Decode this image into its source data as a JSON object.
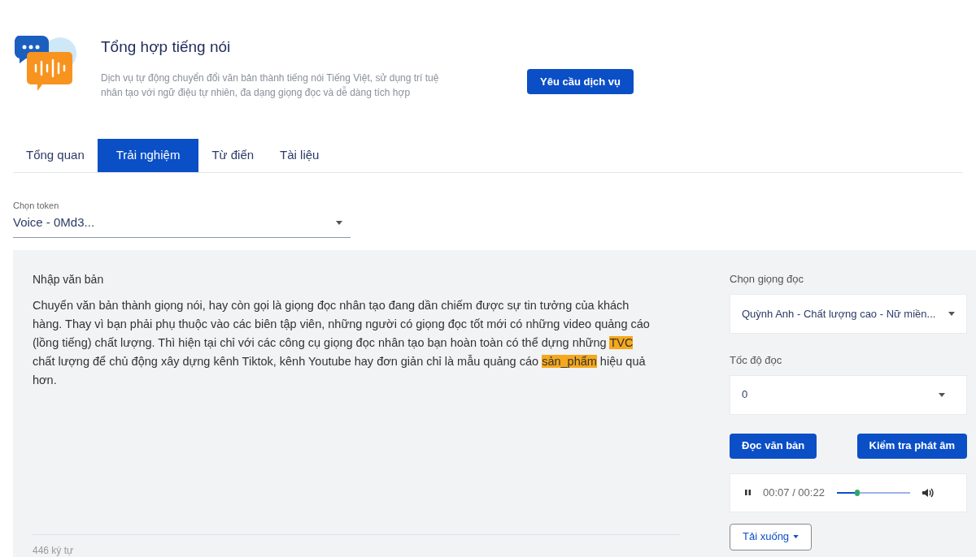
{
  "header": {
    "title": "Tổng hợp tiếng nói",
    "description": "Dịch vụ tự động chuyển đổi văn bản thành tiếng nói Tiếng Việt, sử dụng trí tuệ nhân tạo với ngữ điệu tự nhiên, đa dạng giọng đọc và dễ dàng tích hợp",
    "button": "Yêu cầu dịch vụ"
  },
  "tabs": [
    {
      "label": "Tổng quan",
      "selected": false
    },
    {
      "label": "Trải nghiệm",
      "selected": true
    },
    {
      "label": "Từ điển",
      "selected": false
    },
    {
      "label": "Tài liệu",
      "selected": false
    }
  ],
  "token": {
    "label": "Chọn token",
    "value": "Voice - 0Md3..."
  },
  "editor": {
    "label": "Nhập văn bản",
    "segments": [
      {
        "text": "Chuyển văn bản thành giọng nói, hay còn gọi là giọng đọc nhân tạo đang dần chiếm được sự tin tưởng của khách hàng. Thay vì bạn phải phụ thuộc vào các biên tập viên, những người có giọng đọc tốt mới có những video quảng cáo (lồng tiếng) chất lượng. Thì hiện tại chỉ với các công cụ giọng đọc nhân tạo bạn hoàn toàn có thể dựng những ",
        "highlighted": false
      },
      {
        "text": "TVC",
        "highlighted": true
      },
      {
        "text": " chất lượng để chủ động xây dựng kênh Tiktok, kênh Youtube hay đơn giản chỉ là mẫu quảng cáo ",
        "highlighted": false
      },
      {
        "text": "sản_phẩm",
        "highlighted": true
      },
      {
        "text": " hiệu quả hơn.",
        "highlighted": false
      }
    ],
    "count": "446 ký tự"
  },
  "voice": {
    "label": "Chọn giọng đọc",
    "value": "Quỳnh Anh - Chất lượng cao - Nữ miền..."
  },
  "speed": {
    "label": "Tốc độ đọc",
    "value": "0"
  },
  "buttons": [
    "Đọc văn bản",
    "Kiểm tra phát âm"
  ],
  "player": {
    "time": "00:07 / 00:22",
    "level": 0.28
  },
  "download": "Tải xuống"
}
